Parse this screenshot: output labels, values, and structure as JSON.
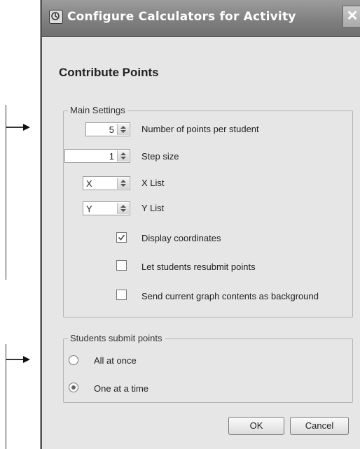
{
  "window": {
    "title": "Configure Calculators for Activity",
    "close_glyph": "✕"
  },
  "section_heading": "Contribute Points",
  "main_settings": {
    "legend": "Main Settings",
    "points_per_student": {
      "value": "5",
      "label": "Number of points per student"
    },
    "step_size": {
      "value": "1",
      "label": "Step size"
    },
    "x_list": {
      "value": "X",
      "label": "X List"
    },
    "y_list": {
      "value": "Y",
      "label": "Y List"
    },
    "display_coordinates": {
      "label": "Display coordinates",
      "checked": true
    },
    "resubmit": {
      "label": "Let students resubmit points",
      "checked": false
    },
    "send_background": {
      "label": "Send current graph contents as background",
      "checked": false
    }
  },
  "students_submit": {
    "legend": "Students submit points",
    "options": [
      {
        "label": "All at once",
        "selected": false
      },
      {
        "label": "One at a time",
        "selected": true
      }
    ]
  },
  "buttons": {
    "ok": "OK",
    "cancel": "Cancel"
  }
}
